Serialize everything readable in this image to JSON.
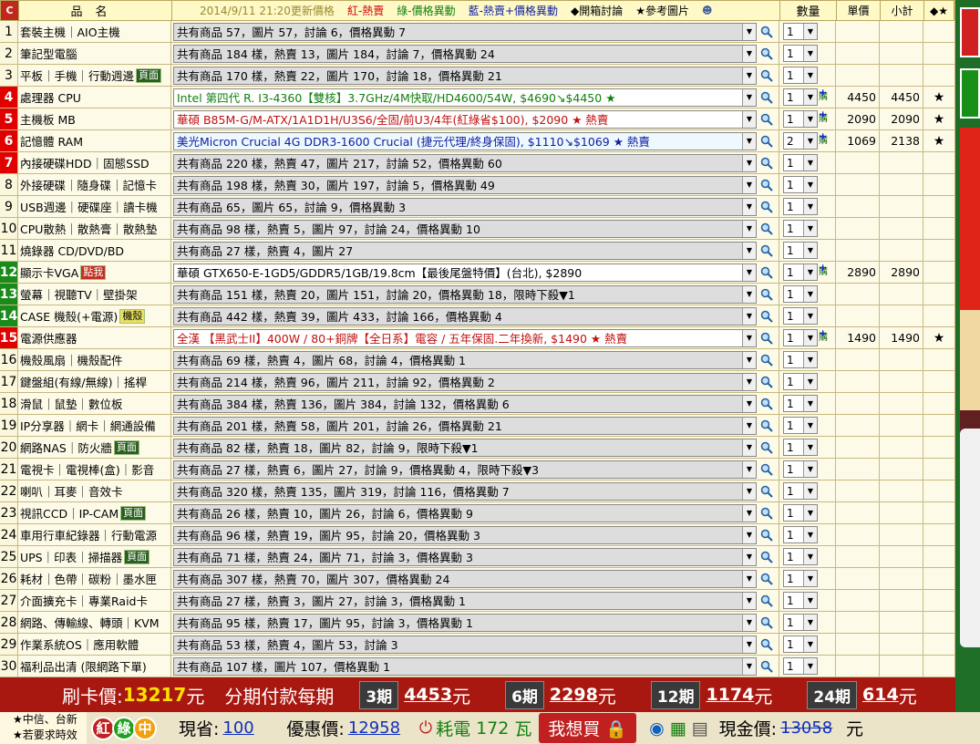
{
  "header": {
    "c_label": "C",
    "name_label": "品名",
    "date_text": "2014/9/11 21:20更新價格",
    "legend_red": "紅-熱賣",
    "legend_green": "綠-價格異動",
    "legend_blue": "藍-熱賣+價格異動",
    "legend_open": "◆開箱討論",
    "legend_ref": "★參考圖片",
    "qty_label": "數量",
    "price_label": "單價",
    "subtotal_label": "小計",
    "star_label": "◆★"
  },
  "rows": [
    {
      "num": "1",
      "cat": "套裝主機｜AIO主機",
      "tag": "",
      "text": "共有商品 57，圖片 57，討論 6，價格異動 7",
      "qty": "1",
      "price": "",
      "subtotal": "",
      "star": "",
      "style": "gray",
      "color": "",
      "hl": ""
    },
    {
      "num": "2",
      "cat": "筆記型電腦",
      "tag": "",
      "text": "共有商品 184 樣，熱賣 13，圖片 184，討論 7，價格異動 24",
      "qty": "1",
      "price": "",
      "subtotal": "",
      "star": "",
      "style": "gray",
      "color": "",
      "hl": ""
    },
    {
      "num": "3",
      "cat": "平板｜手機｜行動週邊",
      "tag": "頁面",
      "text": "共有商品 170 樣，熱賣 22，圖片 170，討論 18，價格異動 21",
      "qty": "1",
      "price": "",
      "subtotal": "",
      "star": "",
      "style": "gray",
      "color": "",
      "hl": ""
    },
    {
      "num": "4",
      "cat": "處理器 CPU",
      "tag": "",
      "text": "Intel 第四代 R. I3-4360【雙核】3.7GHz/4M快取/HD4600/54W, $4690↘$4450 ★",
      "qty": "1",
      "price": "4450",
      "subtotal": "4450",
      "star": "★",
      "style": "white",
      "color": "green",
      "hl": "red",
      "buy": true
    },
    {
      "num": "5",
      "cat": "主機板 MB",
      "tag": "",
      "text": "華碩 B85M-G/M-ATX/1A1D1H/U3S6/全固/前U3/4年(紅綠省$100), $2090 ★ 熱賣",
      "qty": "1",
      "price": "2090",
      "subtotal": "2090",
      "star": "★",
      "style": "white",
      "color": "red",
      "hl": "red",
      "buy": true
    },
    {
      "num": "6",
      "cat": "記憶體 RAM",
      "tag": "",
      "text": "美光Micron Crucial 4G DDR3-1600 Crucial (捷元代理/終身保固), $1110↘$1069 ★ 熱賣",
      "qty": "2",
      "price": "1069",
      "subtotal": "2138",
      "star": "★",
      "style": "lb",
      "color": "blue",
      "hl": "red",
      "buy": true
    },
    {
      "num": "7",
      "cat": "內接硬碟HDD｜固態SSD",
      "tag": "",
      "text": "共有商品 220 樣，熱賣 47，圖片 217，討論 52，價格異動 60",
      "qty": "1",
      "price": "",
      "subtotal": "",
      "star": "",
      "style": "gray",
      "color": "",
      "hl": "red"
    },
    {
      "num": "8",
      "cat": "外接硬碟｜隨身碟｜記憶卡",
      "tag": "",
      "text": "共有商品 198 樣，熱賣 30，圖片 197，討論 5，價格異動 49",
      "qty": "1",
      "price": "",
      "subtotal": "",
      "star": "",
      "style": "gray",
      "color": "",
      "hl": ""
    },
    {
      "num": "9",
      "cat": "USB週邊｜硬碟座｜讀卡機",
      "tag": "",
      "text": "共有商品 65，圖片 65，討論 9，價格異動 3",
      "qty": "1",
      "price": "",
      "subtotal": "",
      "star": "",
      "style": "gray",
      "color": "",
      "hl": ""
    },
    {
      "num": "10",
      "cat": "CPU散熱｜散熱膏｜散熱墊",
      "tag": "",
      "text": "共有商品 98 樣，熱賣 5，圖片 97，討論 24，價格異動 10",
      "qty": "1",
      "price": "",
      "subtotal": "",
      "star": "",
      "style": "gray",
      "color": "",
      "hl": ""
    },
    {
      "num": "11",
      "cat": "燒錄器 CD/DVD/BD",
      "tag": "",
      "text": "共有商品 27 樣，熱賣 4，圖片 27",
      "qty": "1",
      "price": "",
      "subtotal": "",
      "star": "",
      "style": "gray",
      "color": "",
      "hl": ""
    },
    {
      "num": "12",
      "cat": "顯示卡VGA",
      "tag": "點我",
      "tagc": "red",
      "text": "華碩 GTX650-E-1GD5/GDDR5/1GB/19.8cm【最後尾盤特價】(台北), $2890",
      "qty": "1",
      "price": "2890",
      "subtotal": "2890",
      "star": "",
      "style": "white",
      "color": "",
      "hl": "green",
      "buy": true
    },
    {
      "num": "13",
      "cat": "螢幕｜視聽TV｜壁掛架",
      "tag": "",
      "text": "共有商品 151 樣，熱賣 20，圖片 151，討論 20，價格異動 18，限時下殺▼1",
      "qty": "1",
      "price": "",
      "subtotal": "",
      "star": "",
      "style": "gray",
      "color": "",
      "hl": "green"
    },
    {
      "num": "14",
      "cat": "CASE 機殼(+電源)",
      "tag": "機殼",
      "tagc": "yl",
      "text": "共有商品 442 樣，熱賣 39，圖片 433，討論 166，價格異動 4",
      "qty": "1",
      "price": "",
      "subtotal": "",
      "star": "",
      "style": "gray",
      "color": "",
      "hl": "green"
    },
    {
      "num": "15",
      "cat": "電源供應器",
      "tag": "",
      "text": "全漢 【黑武士II】400W / 80+銅牌【全日系】電容 / 五年保固.二年換新, $1490 ★ 熱賣",
      "qty": "1",
      "price": "1490",
      "subtotal": "1490",
      "star": "★",
      "style": "white",
      "color": "red",
      "hl": "red",
      "buy": true
    },
    {
      "num": "16",
      "cat": "機殼風扇｜機殼配件",
      "tag": "",
      "text": "共有商品 69 樣，熱賣 4，圖片 68，討論 4，價格異動 1",
      "qty": "1",
      "price": "",
      "subtotal": "",
      "star": "",
      "style": "gray",
      "color": "",
      "hl": ""
    },
    {
      "num": "17",
      "cat": "鍵盤組(有線/無線)｜搖桿",
      "tag": "",
      "text": "共有商品 214 樣，熱賣 96，圖片 211，討論 92，價格異動 2",
      "qty": "1",
      "price": "",
      "subtotal": "",
      "star": "",
      "style": "gray",
      "color": "",
      "hl": ""
    },
    {
      "num": "18",
      "cat": "滑鼠｜鼠墊｜數位板",
      "tag": "",
      "text": "共有商品 384 樣，熱賣 136，圖片 384，討論 132，價格異動 6",
      "qty": "1",
      "price": "",
      "subtotal": "",
      "star": "",
      "style": "gray",
      "color": "",
      "hl": ""
    },
    {
      "num": "19",
      "cat": "IP分享器｜網卡｜網通設備",
      "tag": "",
      "text": "共有商品 201 樣，熱賣 58，圖片 201，討論 26，價格異動 21",
      "qty": "1",
      "price": "",
      "subtotal": "",
      "star": "",
      "style": "gray",
      "color": "",
      "hl": ""
    },
    {
      "num": "20",
      "cat": "網路NAS｜防火牆",
      "tag": "頁面",
      "text": "共有商品 82 樣，熱賣 18，圖片 82，討論 9，限時下殺▼1",
      "qty": "1",
      "price": "",
      "subtotal": "",
      "star": "",
      "style": "gray",
      "color": "",
      "hl": ""
    },
    {
      "num": "21",
      "cat": "電視卡｜電視棒(盒)｜影音",
      "tag": "",
      "text": "共有商品 27 樣，熱賣 6，圖片 27，討論 9，價格異動 4，限時下殺▼3",
      "qty": "1",
      "price": "",
      "subtotal": "",
      "star": "",
      "style": "gray",
      "color": "",
      "hl": ""
    },
    {
      "num": "22",
      "cat": "喇叭｜耳麥｜音效卡",
      "tag": "",
      "text": "共有商品 320 樣，熱賣 135，圖片 319，討論 116，價格異動 7",
      "qty": "1",
      "price": "",
      "subtotal": "",
      "star": "",
      "style": "gray",
      "color": "",
      "hl": ""
    },
    {
      "num": "23",
      "cat": "視訊CCD｜IP-CAM",
      "tag": "頁面",
      "text": "共有商品 26 樣，熱賣 10，圖片 26，討論 6，價格異動 9",
      "qty": "1",
      "price": "",
      "subtotal": "",
      "star": "",
      "style": "gray",
      "color": "",
      "hl": ""
    },
    {
      "num": "24",
      "cat": "車用行車紀錄器｜行動電源",
      "tag": "",
      "text": "共有商品 96 樣，熱賣 19，圖片 95，討論 20，價格異動 3",
      "qty": "1",
      "price": "",
      "subtotal": "",
      "star": "",
      "style": "gray",
      "color": "",
      "hl": ""
    },
    {
      "num": "25",
      "cat": "UPS｜印表｜掃描器",
      "tag": "頁面",
      "text": "共有商品 71 樣，熱賣 24，圖片 71，討論 3，價格異動 3",
      "qty": "1",
      "price": "",
      "subtotal": "",
      "star": "",
      "style": "gray",
      "color": "",
      "hl": ""
    },
    {
      "num": "26",
      "cat": "耗材｜色帶｜碳粉｜墨水匣",
      "tag": "",
      "text": "共有商品 307 樣，熱賣 70，圖片 307，價格異動 24",
      "qty": "1",
      "price": "",
      "subtotal": "",
      "star": "",
      "style": "gray",
      "color": "",
      "hl": ""
    },
    {
      "num": "27",
      "cat": "介面擴充卡｜專業Raid卡",
      "tag": "",
      "text": "共有商品 27 樣，熱賣 3，圖片 27，討論 3，價格異動 1",
      "qty": "1",
      "price": "",
      "subtotal": "",
      "star": "",
      "style": "gray",
      "color": "",
      "hl": ""
    },
    {
      "num": "28",
      "cat": "網路、傳輸線、轉頭｜KVM",
      "tag": "",
      "text": "共有商品 95 樣，熱賣 17，圖片 95，討論 3，價格異動 1",
      "qty": "1",
      "price": "",
      "subtotal": "",
      "star": "",
      "style": "gray",
      "color": "",
      "hl": ""
    },
    {
      "num": "29",
      "cat": "作業系統OS｜應用軟體",
      "tag": "",
      "text": "共有商品 53 樣，熱賣 4，圖片 53，討論 3",
      "qty": "1",
      "price": "",
      "subtotal": "",
      "star": "",
      "style": "gray",
      "color": "",
      "hl": ""
    },
    {
      "num": "30",
      "cat": "福利品出清 (限網路下單)",
      "tag": "",
      "text": "共有商品 107 樣，圖片 107，價格異動 1",
      "qty": "1",
      "price": "",
      "subtotal": "",
      "star": "",
      "style": "gray",
      "color": "",
      "hl": ""
    }
  ],
  "buy_label": "購",
  "footer": {
    "card_label": "刷卡價:",
    "card_price": "13217",
    "yuan": "元",
    "installment_label": "分期付款每期",
    "installments": [
      {
        "period": "3期",
        "amount": "4453"
      },
      {
        "period": "6期",
        "amount": "2298"
      },
      {
        "period": "12期",
        "amount": "1174"
      },
      {
        "period": "24期",
        "amount": "614"
      }
    ],
    "note1": "★中信、台新",
    "note2": "★若要求時效",
    "circle1": "紅",
    "circle2": "綠",
    "circle3": "中",
    "save_label": "現省:",
    "save_value": "100",
    "discount_label": "優惠價:",
    "discount_value": "12958",
    "power_label": "耗電",
    "power_value": "172",
    "power_unit": "瓦",
    "buy_button": "我想買",
    "cash_label": "現金價:",
    "cash_value": "13058",
    "cash_unit": "元"
  }
}
